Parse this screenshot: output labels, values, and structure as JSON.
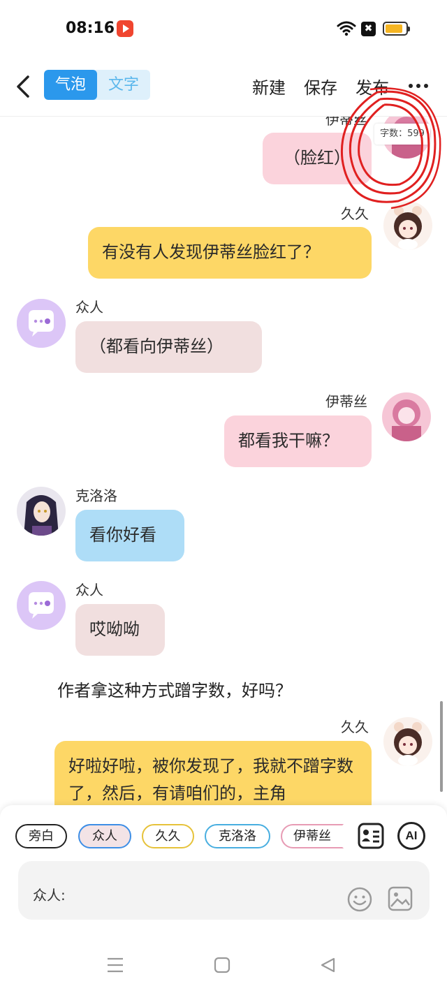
{
  "status_bar": {
    "time": "08:16",
    "close_badge": "✖"
  },
  "toolbar": {
    "mode_bubble": "气泡",
    "mode_text": "文字",
    "new_label": "新建",
    "save_label": "保存",
    "publish_label": "发布"
  },
  "word_count": "字数：599",
  "messages": [
    {
      "name": "伊蒂丝",
      "text": "（脸红）",
      "side": "right",
      "bubble_color": "#fbd3dc"
    },
    {
      "name": "久久",
      "text": "有没有人发现伊蒂丝脸红了？",
      "side": "right",
      "bubble_color": "#fdd766"
    },
    {
      "name": "众人",
      "text": "（都看向伊蒂丝）",
      "side": "left",
      "bubble_color": "#f1dfdf"
    },
    {
      "name": "伊蒂丝",
      "text": "都看我干嘛？",
      "side": "right",
      "bubble_color": "#fbd3dc"
    },
    {
      "name": "克洛洛",
      "text": "看你好看",
      "side": "left",
      "bubble_color": "#aeddf7"
    },
    {
      "name": "众人",
      "text": "哎呦呦",
      "side": "left",
      "bubble_color": "#f1dfdf"
    },
    {
      "name": "",
      "text": "作者拿这种方式蹭字数，好吗？",
      "side": "narration",
      "bubble_color": ""
    },
    {
      "name": "久久",
      "text": "好啦好啦，被你发现了，我就不蹭字数了，然后，有请咱们的，主角",
      "side": "right",
      "bubble_color": "#fdd766"
    }
  ],
  "characters": [
    {
      "label": "旁白",
      "border": "#222222",
      "bg": "#ffffff",
      "selected": false
    },
    {
      "label": "众人",
      "border": "#3d8ee6",
      "bg": "#f3e3e6",
      "selected": true
    },
    {
      "label": "久久",
      "border": "#e6c23a",
      "bg": "#ffffff",
      "selected": false
    },
    {
      "label": "克洛洛",
      "border": "#48aee0",
      "bg": "#ffffff",
      "selected": false
    },
    {
      "label": "伊蒂丝",
      "border": "#e79bb4",
      "bg": "#ffffff",
      "selected": false
    }
  ],
  "ai_label": "AI",
  "input": {
    "speaker_label": "众人:"
  },
  "colors": {
    "accent": "#2b98ec",
    "annotation_red": "#e02020"
  },
  "icons": {
    "back": "back-arrow-icon",
    "more": "more-dots-icon",
    "roles": "role-card-icon",
    "emoji": "emoji-smile-icon",
    "image": "image-icon",
    "menu": "menu-icon",
    "home": "home-square-icon",
    "nav_back": "nav-back-icon"
  }
}
